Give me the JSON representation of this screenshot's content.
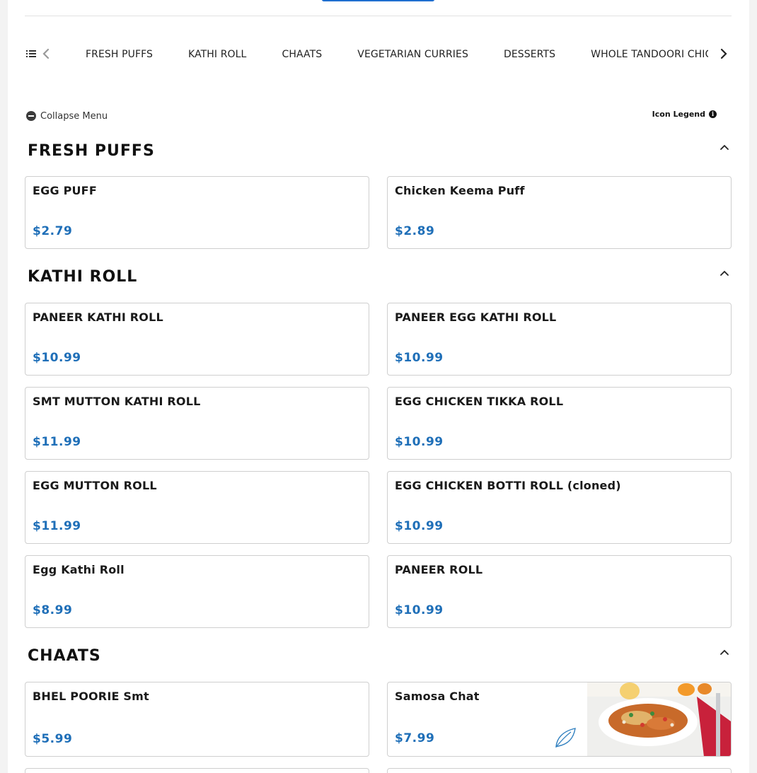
{
  "nav": {
    "categories": [
      "FRESH PUFFS",
      "KATHI ROLL",
      "CHAATS",
      "VEGETARIAN CURRIES",
      "DESSERTS",
      "WHOLE TANDOORI CHICKEN"
    ]
  },
  "toolbar": {
    "collapse_label": "Collapse Menu",
    "legend_label": "Icon Legend"
  },
  "sections": [
    {
      "title": "FRESH PUFFS",
      "items": [
        {
          "name": "EGG PUFF",
          "price": "$2.79"
        },
        {
          "name": "Chicken Keema Puff",
          "price": "$2.89"
        }
      ]
    },
    {
      "title": "KATHI ROLL",
      "items": [
        {
          "name": "PANEER KATHI ROLL",
          "price": "$10.99"
        },
        {
          "name": "PANEER EGG KATHI ROLL",
          "price": "$10.99"
        },
        {
          "name": "SMT MUTTON KATHI ROLL",
          "price": "$11.99"
        },
        {
          "name": "EGG CHICKEN TIKKA ROLL",
          "price": "$10.99"
        },
        {
          "name": "EGG MUTTON ROLL",
          "price": "$11.99"
        },
        {
          "name": "EGG CHICKEN BOTTI ROLL (cloned)",
          "price": "$10.99"
        },
        {
          "name": "Egg Kathi Roll",
          "price": "$8.99"
        },
        {
          "name": "PANEER ROLL",
          "price": "$10.99"
        }
      ]
    },
    {
      "title": "CHAATS",
      "items": [
        {
          "name": "BHEL POORIE Smt",
          "price": "$5.99"
        },
        {
          "name": "Samosa Chat",
          "price": "$7.99",
          "icon": "leaf-icon",
          "has_image": true
        }
      ]
    }
  ],
  "colors": {
    "price": "#1f6fb8",
    "accent": "#1f6fd0",
    "border": "#cfcfcf"
  }
}
